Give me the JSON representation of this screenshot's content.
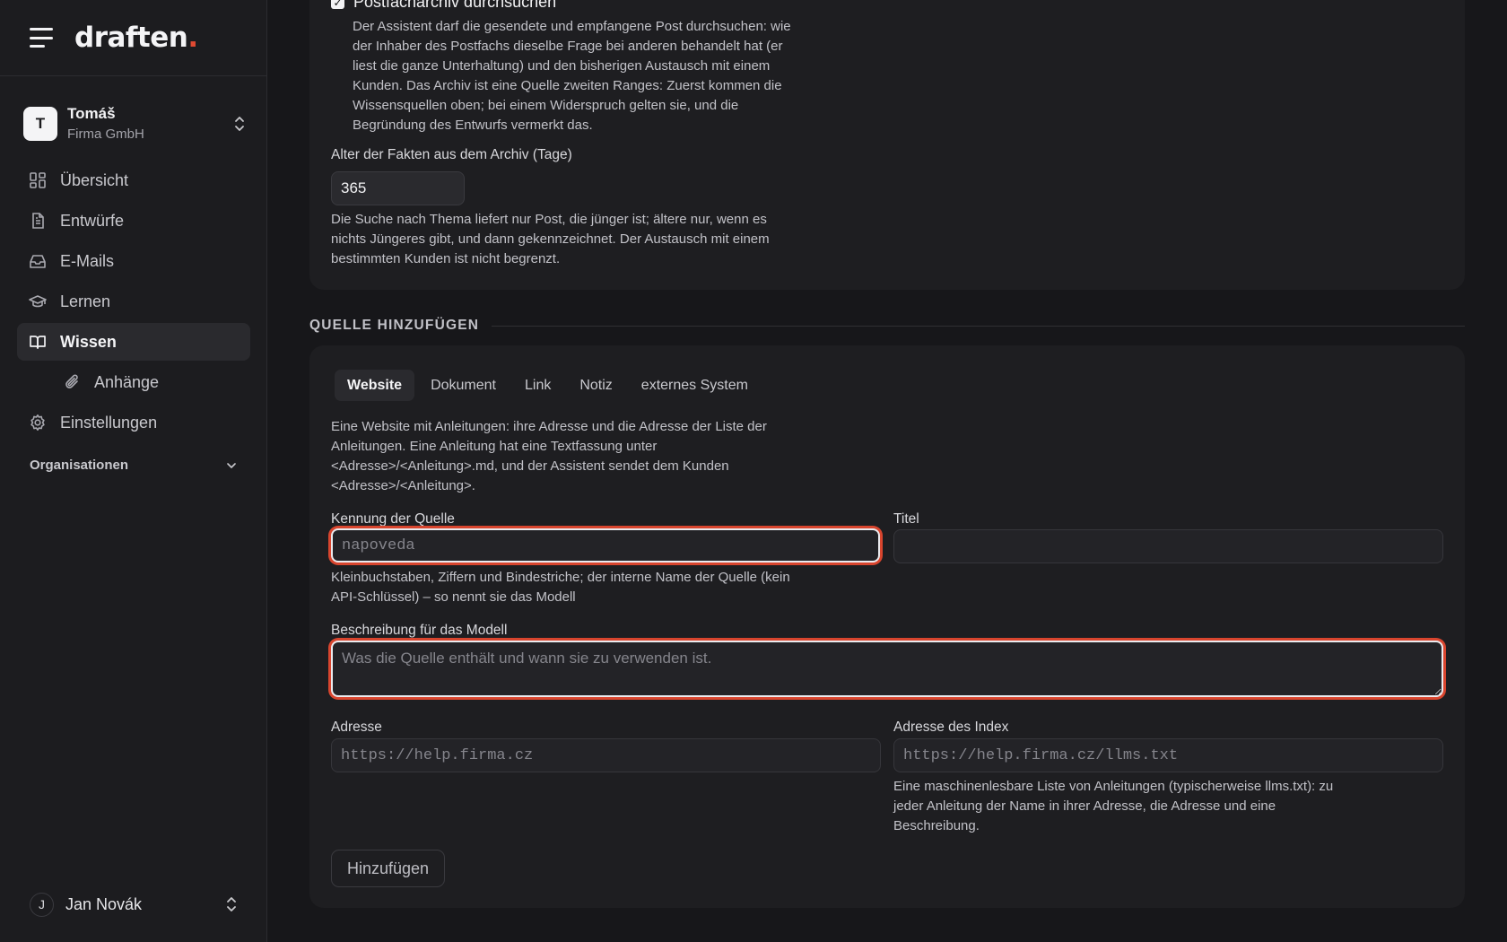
{
  "app": {
    "logo_text": "draften",
    "logo_dot": "."
  },
  "org": {
    "initial": "T",
    "name": "Tomáš",
    "company": "Firma GmbH"
  },
  "nav": {
    "items": [
      {
        "label": "Übersicht",
        "icon": "dashboard-icon"
      },
      {
        "label": "Entwürfe",
        "icon": "document-icon"
      },
      {
        "label": "E-Mails",
        "icon": "inbox-icon"
      },
      {
        "label": "Lernen",
        "icon": "graduation-cap-icon"
      },
      {
        "label": "Wissen",
        "icon": "book-icon",
        "active": true
      },
      {
        "label": "Anhänge",
        "icon": "paperclip-icon",
        "sub": true
      },
      {
        "label": "Einstellungen",
        "icon": "gear-icon"
      }
    ],
    "organisations_label": "Organisationen"
  },
  "user": {
    "initial": "J",
    "name": "Jan Novák"
  },
  "archive": {
    "checkbox_label": "Postfacharchiv durchsuchen",
    "checked": true,
    "help": "Der Assistent darf die gesendete und empfangene Post durchsuchen: wie der Inhaber des Postfachs dieselbe Frage bei anderen behandelt hat (er liest die ganze Unterhaltung) und den bisherigen Austausch mit einem Kunden. Das Archiv ist eine Quelle zweiten Ranges: Zuerst kommen die Wissensquellen oben; bei einem Widerspruch gelten sie, und die Begründung des Entwurfs vermerkt das.",
    "age_label": "Alter der Fakten aus dem Archiv (Tage)",
    "age_value": "365",
    "age_help": "Die Suche nach Thema liefert nur Post, die jünger ist; ältere nur, wenn es nichts Jüngeres gibt, und dann gekennzeichnet. Der Austausch mit einem bestimmten Kunden ist nicht begrenzt."
  },
  "add_source": {
    "section_title": "QUELLE HINZUFÜGEN",
    "tabs": [
      "Website",
      "Dokument",
      "Link",
      "Notiz",
      "externes System"
    ],
    "active_tab": "Website",
    "description": "Eine Website mit Anleitungen: ihre Adresse und die Adresse der Liste der Anleitungen. Eine Anleitung hat eine Textfassung unter <Adresse>/<Anleitung>.md, und der Assistent sendet dem Kunden <Adresse>/<Anleitung>.",
    "id_label": "Kennung der Quelle",
    "id_placeholder": "napoveda",
    "id_help": "Kleinbuchstaben, Ziffern und Bindestriche; der interne Name der Quelle (kein API-Schlüssel) – so nennt sie das Modell",
    "title_label": "Titel",
    "title_value": "",
    "model_desc_label": "Beschreibung für das Modell",
    "model_desc_placeholder": "Was die Quelle enthält und wann sie zu verwenden ist.",
    "address_label": "Adresse",
    "address_placeholder": "https://help.firma.cz",
    "index_label": "Adresse des Index",
    "index_placeholder": "https://help.firma.cz/llms.txt",
    "index_help": "Eine maschinenlesbare Liste von Anleitungen (typischerweise llms.txt): zu jeder Anleitung der Name in ihrer Adresse, die Adresse und eine Beschreibung.",
    "submit_label": "Hinzufügen"
  },
  "colors": {
    "accent": "#e04a32",
    "background": "#17171a",
    "card": "#1e1e21",
    "highlight_ring": "#d8452e"
  }
}
